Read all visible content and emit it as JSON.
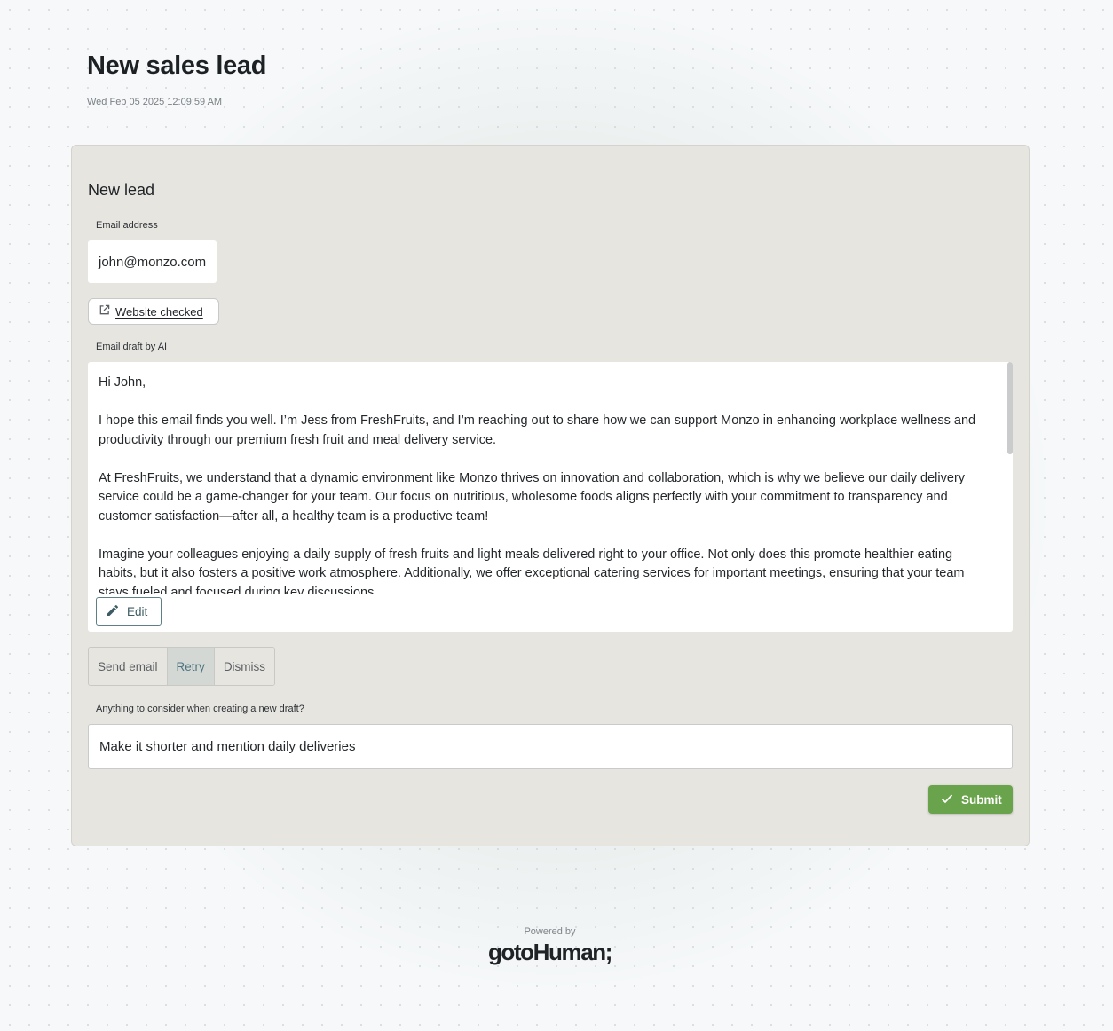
{
  "header": {
    "title": "New sales lead",
    "timestamp": "Wed Feb 05 2025 12:09:59 AM"
  },
  "form": {
    "title": "New lead",
    "email_label": "Email address",
    "email_value": "john@monzo.com",
    "website_link_label": "Website checked",
    "draft_label": "Email draft by AI",
    "draft_text": "Hi John,\n\nI hope this email finds you well. I’m Jess from FreshFruits, and I’m reaching out to share how we can support Monzo in enhancing workplace wellness and productivity through our premium fresh fruit and meal delivery service.\n\nAt FreshFruits, we understand that a dynamic environment like Monzo thrives on innovation and collaboration, which is why we believe our daily delivery service could be a game-changer for your team. Our focus on nutritious, wholesome foods aligns perfectly with your commitment to transparency and customer satisfaction—after all, a healthy team is a productive team!\n\nImagine your colleagues enjoying a daily supply of fresh fruits and light meals delivered right to your office. Not only does this promote healthier eating habits, but it also fosters a positive work atmosphere. Additionally, we offer exceptional catering services for important meetings, ensuring that your team stays fueled and focused during key discussions.",
    "edit_label": "Edit",
    "actions": [
      {
        "label": "Send email",
        "selected": false
      },
      {
        "label": "Retry",
        "selected": true
      },
      {
        "label": "Dismiss",
        "selected": false
      }
    ],
    "feedback_label": "Anything to consider when creating a new draft?",
    "feedback_value": "Make it shorter and mention daily deliveries",
    "submit_label": "Submit"
  },
  "footer": {
    "powered_by": "Powered by",
    "brand": "gotoHuman;"
  },
  "colors": {
    "accent": "#69a34b",
    "selected_text": "#4e7580",
    "card_bg": "#e6e5e0"
  },
  "icons": {
    "link": "external-link-icon",
    "edit": "pencil-icon",
    "submit": "check-icon"
  }
}
